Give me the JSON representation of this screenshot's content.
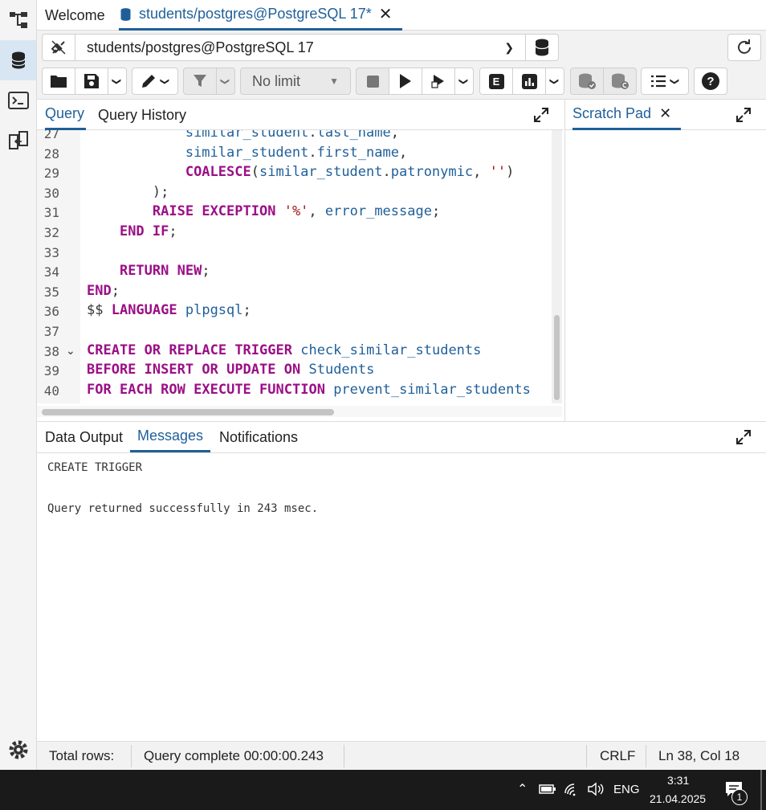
{
  "tabs": {
    "welcome": "Welcome",
    "query": "students/postgres@PostgreSQL 17*"
  },
  "toolbar": {
    "connection": "students/postgres@PostgreSQL 17",
    "limit": "No limit"
  },
  "editor_tabs": {
    "query": "Query",
    "history": "Query History",
    "scratch": "Scratch Pad"
  },
  "code_lines": [
    {
      "n": "27",
      "text": "            similar_student.last_name,"
    },
    {
      "n": "28",
      "text": "            similar_student.first_name,"
    },
    {
      "n": "29",
      "text": "            COALESCE(similar_student.patronymic, '')"
    },
    {
      "n": "30",
      "text": "        );"
    },
    {
      "n": "31",
      "text": "        RAISE EXCEPTION '%', error_message;"
    },
    {
      "n": "32",
      "text": "    END IF;"
    },
    {
      "n": "33",
      "text": ""
    },
    {
      "n": "34",
      "text": "    RETURN NEW;"
    },
    {
      "n": "35",
      "text": "END;"
    },
    {
      "n": "36",
      "text": "$$ LANGUAGE plpgsql;"
    },
    {
      "n": "37",
      "text": ""
    },
    {
      "n": "38",
      "text": "CREATE OR REPLACE TRIGGER check_similar_students"
    },
    {
      "n": "39",
      "text": "BEFORE INSERT OR UPDATE ON Students"
    },
    {
      "n": "40",
      "text": "FOR EACH ROW EXECUTE FUNCTION prevent_similar_students"
    }
  ],
  "results_tabs": {
    "data_output": "Data Output",
    "messages": "Messages",
    "notifications": "Notifications"
  },
  "messages": {
    "line1": "CREATE TRIGGER",
    "line2": "Query returned successfully in 243 msec."
  },
  "status": {
    "total_rows": "Total rows:",
    "query_complete": "Query complete 00:00:00.243",
    "eol": "CRLF",
    "position": "Ln 38, Col 18"
  },
  "taskbar": {
    "lang": "ENG",
    "time": "3:31",
    "date": "21.04.2025",
    "notif_count": "1"
  },
  "colors": {
    "accent": "#1f5f99",
    "keyword": "#9b0f86",
    "string": "#a31515"
  }
}
